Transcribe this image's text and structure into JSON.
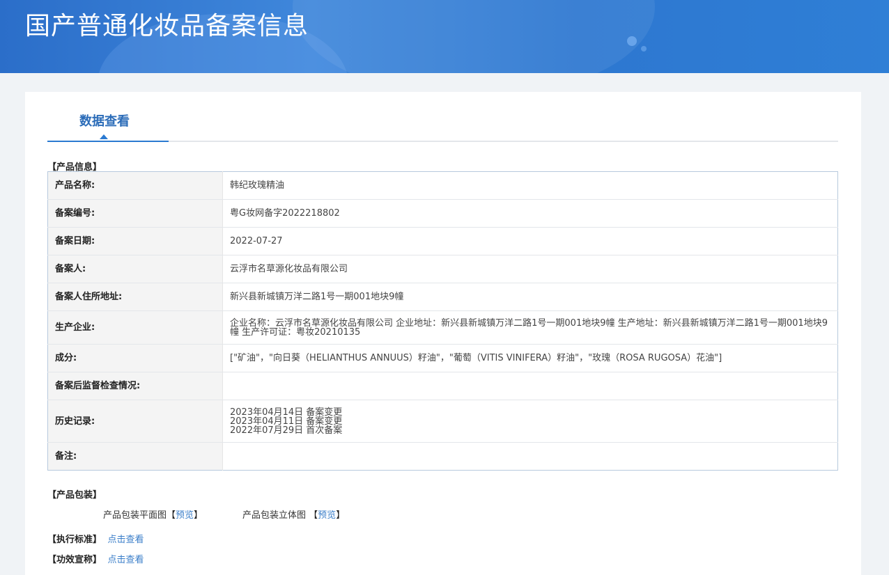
{
  "header": {
    "title": "国产普通化妆品备案信息"
  },
  "tabs": [
    {
      "label": "数据查看"
    }
  ],
  "product_info": {
    "section_title": "【产品信息】",
    "rows": [
      {
        "label": "产品名称:",
        "value": "韩纪玫瑰精油"
      },
      {
        "label": "备案编号:",
        "value": "粤G妆网备字2022218802"
      },
      {
        "label": "备案日期:",
        "value": "2022-07-27"
      },
      {
        "label": "备案人:",
        "value": "云浮市名草源化妆品有限公司"
      },
      {
        "label": "备案人住所地址:",
        "value": "新兴县新城镇万洋二路1号一期001地块9幢"
      },
      {
        "label": "生产企业:",
        "value": "企业名称：云浮市名草源化妆品有限公司 企业地址：新兴县新城镇万洋二路1号一期001地块9幢 生产地址：新兴县新城镇万洋二路1号一期001地块9幢 生产许可证：粤妆20210135"
      },
      {
        "label": "成分:",
        "value": "[\"矿油\"，\"向日葵（HELIANTHUS ANNUUS）籽油\"，\"葡萄（VITIS VINIFERA）籽油\"，\"玫瑰（ROSA RUGOSA）花油\"]"
      },
      {
        "label": "备案后监督检查情况:",
        "value": ""
      },
      {
        "label": "历史记录:",
        "value_lines": [
          "2023年04月14日 备案变更",
          "2023年04月11日 备案变更",
          "2022年07月29日 首次备案"
        ]
      },
      {
        "label": "备注:",
        "value": ""
      }
    ]
  },
  "packaging": {
    "section_title": "【产品包装】",
    "flat_label": "产品包装平面图",
    "flat_link": "预览",
    "three_d_label": "产品包装立体图",
    "three_d_link": "预览",
    "bracket_open": "【",
    "bracket_close": "】"
  },
  "standard": {
    "section_title": "【执行标准】",
    "link": "点击查看"
  },
  "efficacy": {
    "section_title": "【功效宣称】",
    "link": "点击查看"
  }
}
